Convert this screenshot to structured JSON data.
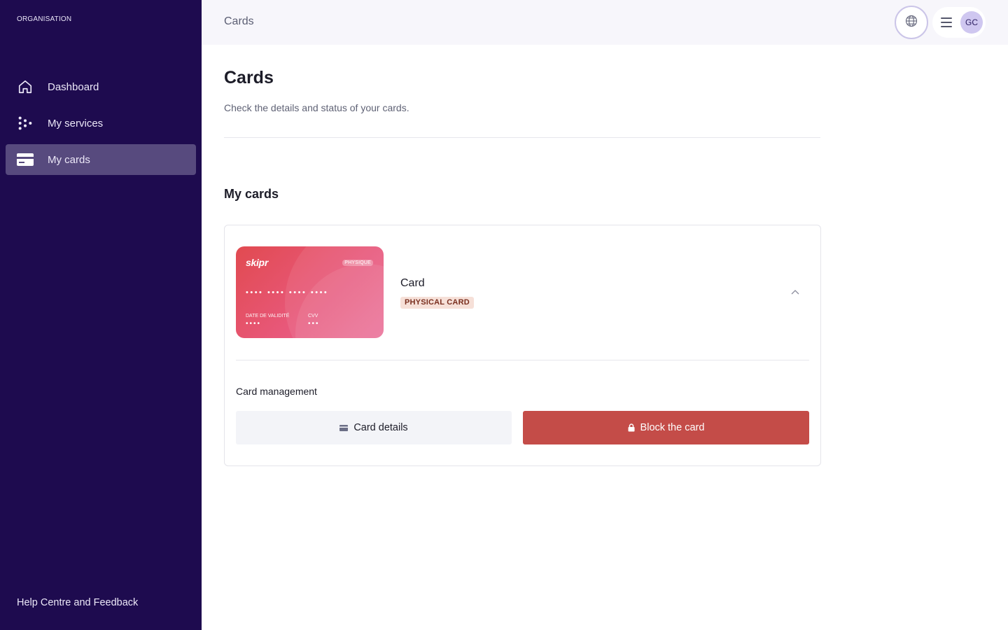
{
  "sidebar": {
    "org_label": "ORGANISATION",
    "items": [
      {
        "label": "Dashboard",
        "icon": "home-icon",
        "active": false
      },
      {
        "label": "My services",
        "icon": "services-dots-icon",
        "active": false
      },
      {
        "label": "My cards",
        "icon": "credit-card-icon",
        "active": true
      }
    ],
    "help_label": "Help Centre and Feedback"
  },
  "topbar": {
    "title": "Cards",
    "language_icon": "globe-icon",
    "menu_icon": "hamburger-icon",
    "avatar_initials": "GC"
  },
  "main": {
    "title": "Cards",
    "subtitle": "Check the details and status of your cards.",
    "section_title": "My cards"
  },
  "card": {
    "brand": "skipr",
    "tag": "PHYSIQUE",
    "number_masked": "•••• •••• •••• ••••",
    "expiry_label": "DATE DE VALIDITÉ",
    "expiry_masked": "••••",
    "cvv_label": "CVV",
    "cvv_masked": "•••",
    "name": "Card",
    "type_badge": "PHYSICAL CARD",
    "management_title": "Card management",
    "details_button": "Card details",
    "block_button": "Block the card"
  },
  "colors": {
    "sidebar_bg": "#1e0b4f",
    "sidebar_active": "#574a7e",
    "block_button": "#c44c48",
    "badge_bg": "#f6e0d8",
    "card_gradient_start": "#e14a50",
    "card_gradient_end": "#ea6c96"
  }
}
